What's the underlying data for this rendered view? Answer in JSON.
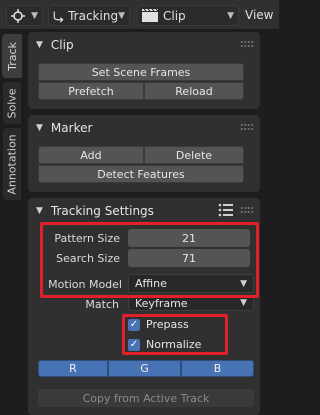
{
  "header": {
    "tool_icon": "crosshair-icon",
    "mode": {
      "icon": "tracking-icon",
      "label": "Tracking"
    },
    "clip": {
      "icon": "clip-icon",
      "label": "Clip"
    },
    "view_menu": "View"
  },
  "tabs": [
    "Track",
    "Solve",
    "Annotation"
  ],
  "clip_panel": {
    "title": "Clip",
    "set_scene_frames": "Set Scene Frames",
    "prefetch": "Prefetch",
    "reload": "Reload"
  },
  "marker_panel": {
    "title": "Marker",
    "add": "Add",
    "delete": "Delete",
    "detect_features": "Detect Features"
  },
  "tracking_settings": {
    "title": "Tracking Settings",
    "pattern_size": {
      "label": "Pattern Size",
      "value": "21"
    },
    "search_size": {
      "label": "Search Size",
      "value": "71"
    },
    "motion_model": {
      "label": "Motion Model",
      "value": "Affine"
    },
    "match": {
      "label": "Match",
      "value": "Keyframe"
    },
    "prepass": {
      "label": "Prepass",
      "checked": true
    },
    "normalize": {
      "label": "Normalize",
      "checked": true
    },
    "channels": [
      "R",
      "G",
      "B"
    ],
    "copy_from_active": "Copy from Active Track"
  },
  "colors": {
    "accent": "#4772b3",
    "highlight": "#e0212b"
  }
}
